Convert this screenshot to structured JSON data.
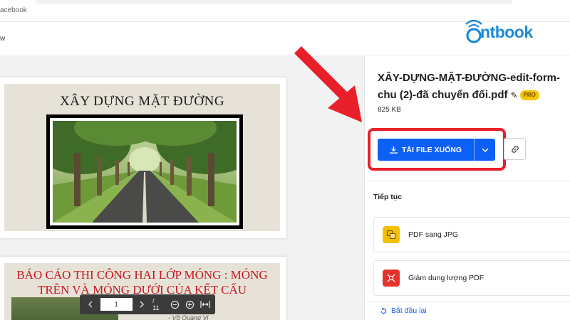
{
  "browser": {
    "url_fragment": "acebook",
    "sub_text": "w"
  },
  "viewer": {
    "page1": {
      "title": "XÂY DỰNG MẶT ĐƯỜNG"
    },
    "page2": {
      "title_line1": "BÁO CÁO THI CÔNG HAI LỚP MÓNG : MÓNG",
      "title_line2": "TRÊN VÀ MÓNG DƯỚI CỦA KẾT CẤU",
      "author": "- Võ Quang Vi"
    },
    "pager": {
      "current_page": "1",
      "total": "/ 11"
    }
  },
  "logo": {
    "text": "ntbook",
    "color": "#1a8ad8"
  },
  "panel": {
    "file_title": "XÂY-DỰNG-MẶT-ĐƯỜNG-edit-form-chu (2)-đã chuyển đổi.pdf",
    "pro_badge": "PRO",
    "file_size": "825 KB",
    "download_label": "TẢI FILE XUỐNG",
    "continue_label": "Tiếp tục",
    "tools": [
      {
        "label": "PDF sang JPG",
        "icon": "jpg-icon",
        "color": "#f5c000"
      },
      {
        "label": "Giảm dung lượng PDF",
        "icon": "compress-icon",
        "color": "#e5322d"
      }
    ],
    "restart_label": "Bắt đầu lại"
  },
  "colors": {
    "primary": "#0d60f5",
    "highlight": "#e8202a",
    "link": "#1763e8"
  }
}
